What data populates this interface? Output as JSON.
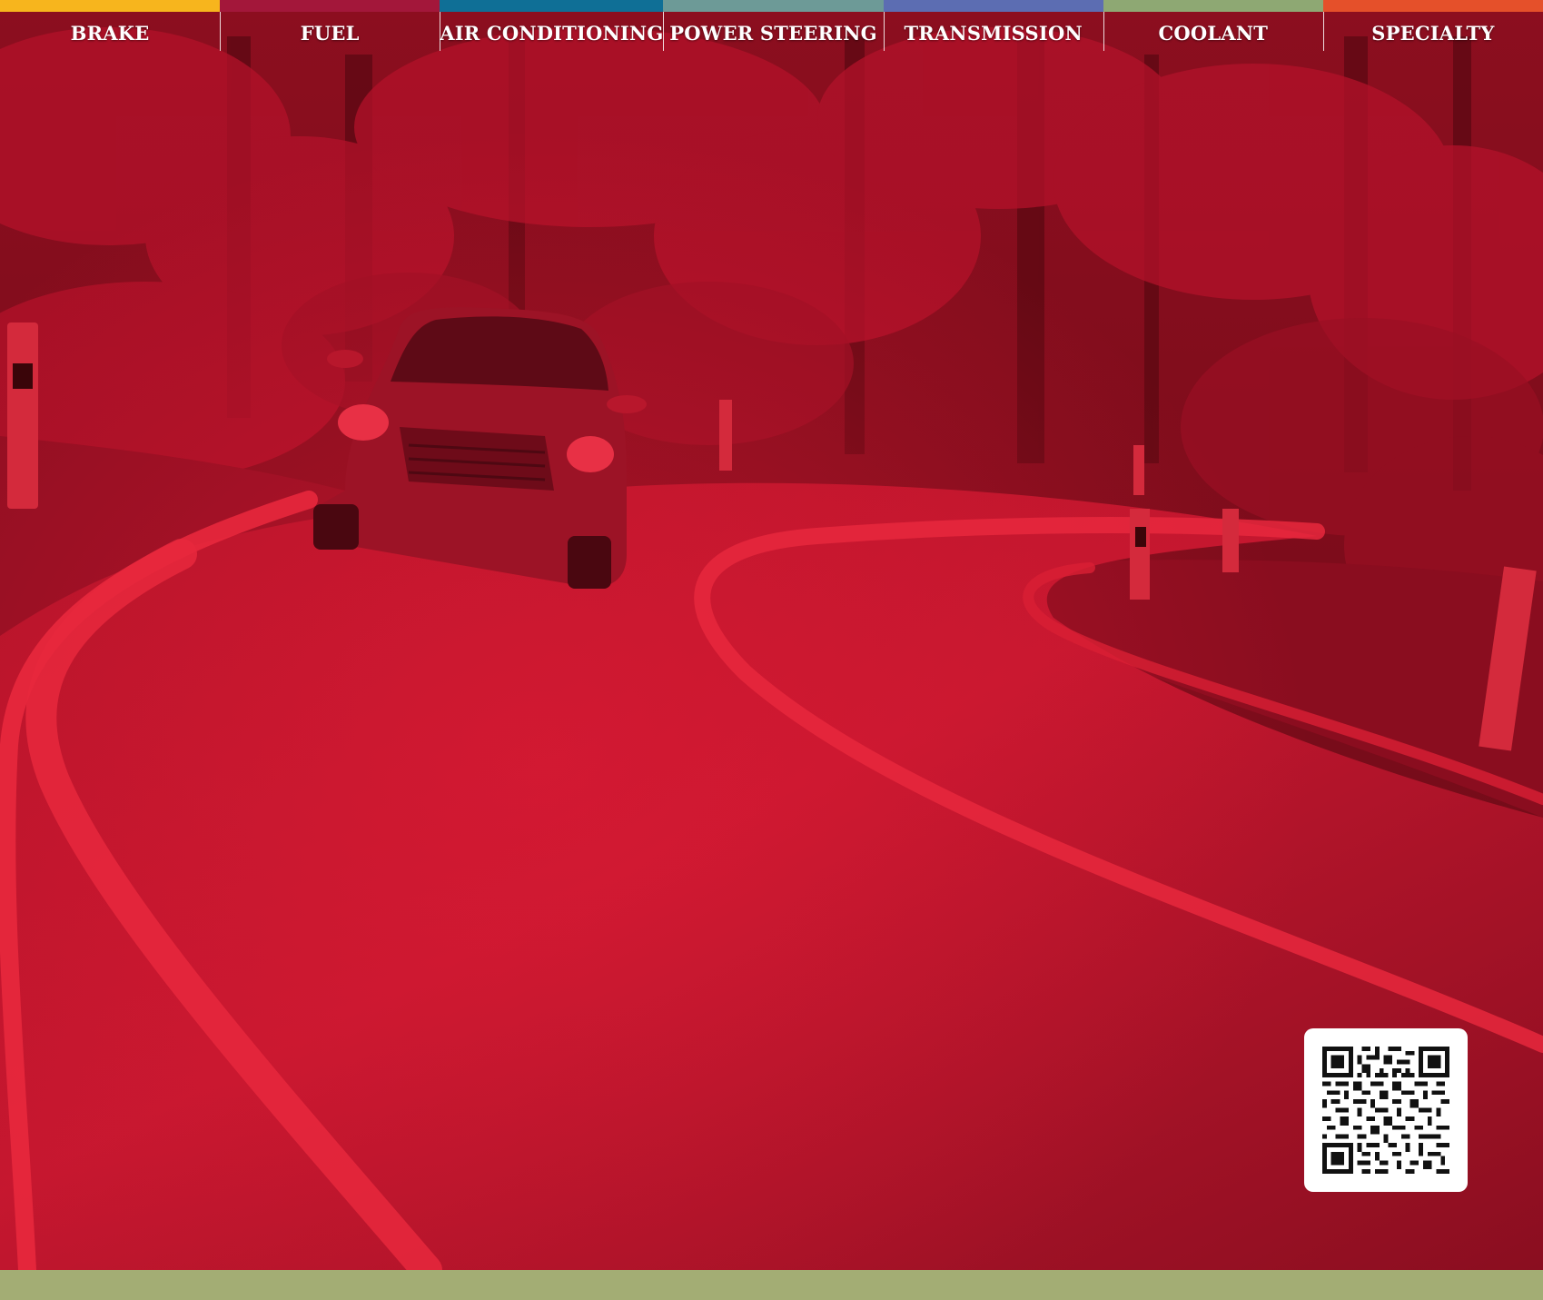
{
  "nav": {
    "tabs": [
      {
        "label": "BRAKE",
        "color": "#f7b51d"
      },
      {
        "label": "FUEL",
        "color": "#a3173a"
      },
      {
        "label": "AIR CONDITIONING",
        "color": "#0f6f96"
      },
      {
        "label": "POWER STEERING",
        "color": "#6d9a97"
      },
      {
        "label": "TRANSMISSION",
        "color": "#5c6db2"
      },
      {
        "label": "COOLANT",
        "color": "#8ea873"
      },
      {
        "label": "SPECIALTY",
        "color": "#e5502a"
      }
    ]
  },
  "hero": {
    "image": "car-on-winding-forest-road",
    "tint_color": "#c8102e"
  },
  "qr": {
    "icon": "qr-code-icon"
  },
  "footer": {
    "color": "#a3ad74"
  }
}
